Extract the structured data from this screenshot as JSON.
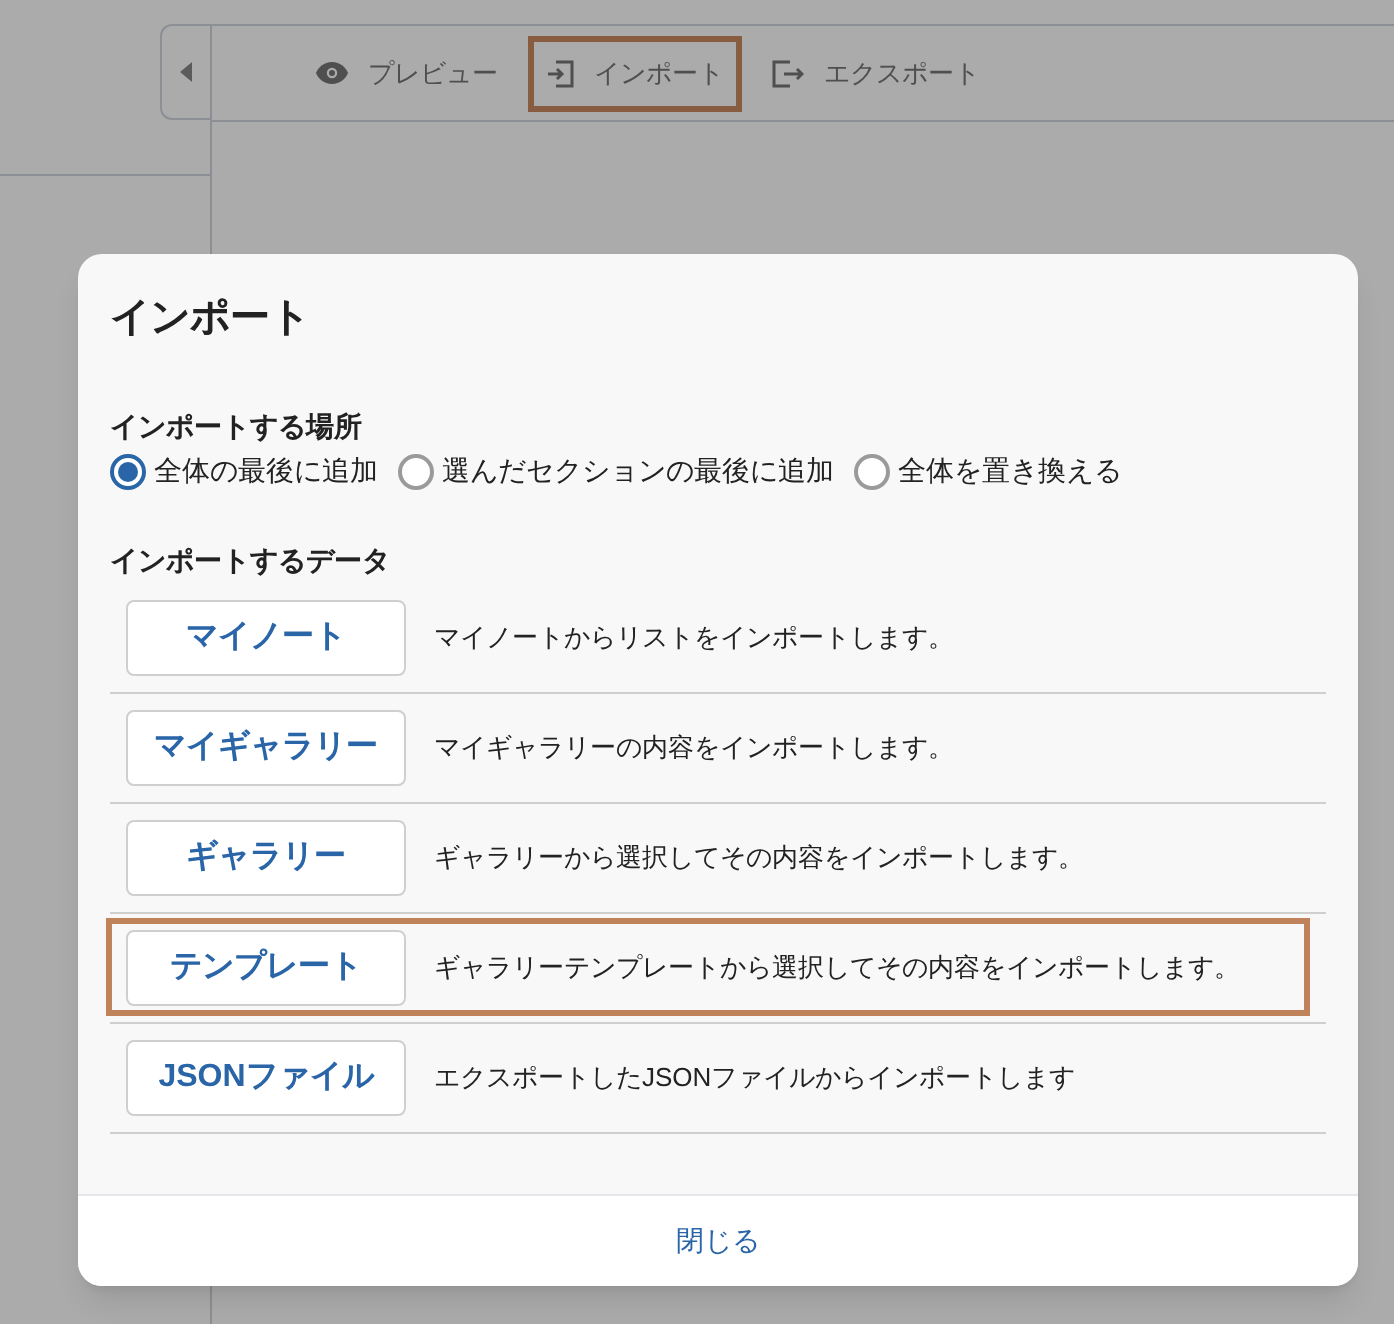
{
  "toolbar": [
    {
      "kind": "eye",
      "label": "プレビュー",
      "highlighted": false
    },
    {
      "kind": "import",
      "label": "インポート",
      "highlighted": true
    },
    {
      "kind": "export",
      "label": "エクスポート",
      "highlighted": false
    }
  ],
  "dialog": {
    "title": "インポート",
    "location_label": "インポートする場所",
    "locations": [
      {
        "label": "全体の最後に追加",
        "selected": true
      },
      {
        "label": "選んだセクションの最後に追加",
        "selected": false
      },
      {
        "label": "全体を置き換える",
        "selected": false
      }
    ],
    "data_label": "インポートするデータ",
    "sources": [
      {
        "button": "マイノート",
        "description": "マイノートからリストをインポートします。",
        "highlighted": false
      },
      {
        "button": "マイギャラリー",
        "description": "マイギャラリーの内容をインポートします。",
        "highlighted": false
      },
      {
        "button": "ギャラリー",
        "description": "ギャラリーから選択してその内容をインポートします。",
        "highlighted": false
      },
      {
        "button": "テンプレート",
        "description": "ギャラリーテンプレートから選択してその内容をインポートします。",
        "highlighted": true
      },
      {
        "button": "JSONファイル",
        "description": "エクスポートしたJSONファイルからインポートします",
        "highlighted": false
      }
    ],
    "close": "閉じる"
  }
}
